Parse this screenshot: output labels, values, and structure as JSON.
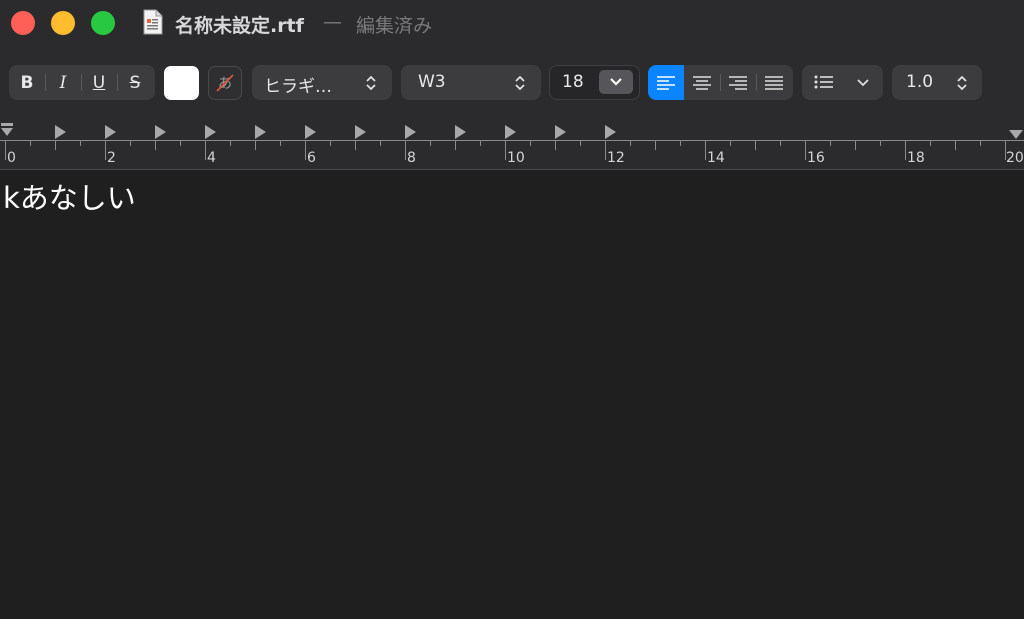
{
  "window": {
    "title": "名称未設定.rtf",
    "separator": "—",
    "status": "編集済み"
  },
  "toolbar": {
    "bold_label": "B",
    "italic_label": "I",
    "underline_label": "U",
    "strike_label": "S",
    "text_color": "#ffffff",
    "font_family": "ヒラギ…",
    "font_weight": "W3",
    "font_size": "18",
    "line_spacing": "1.0",
    "accent_color": "#0a84ff"
  },
  "ruler": {
    "labels": [
      "0",
      "2",
      "4",
      "6",
      "8",
      "10",
      "12",
      "14",
      "16",
      "18",
      "20"
    ]
  },
  "document": {
    "text": "kあなしい"
  }
}
